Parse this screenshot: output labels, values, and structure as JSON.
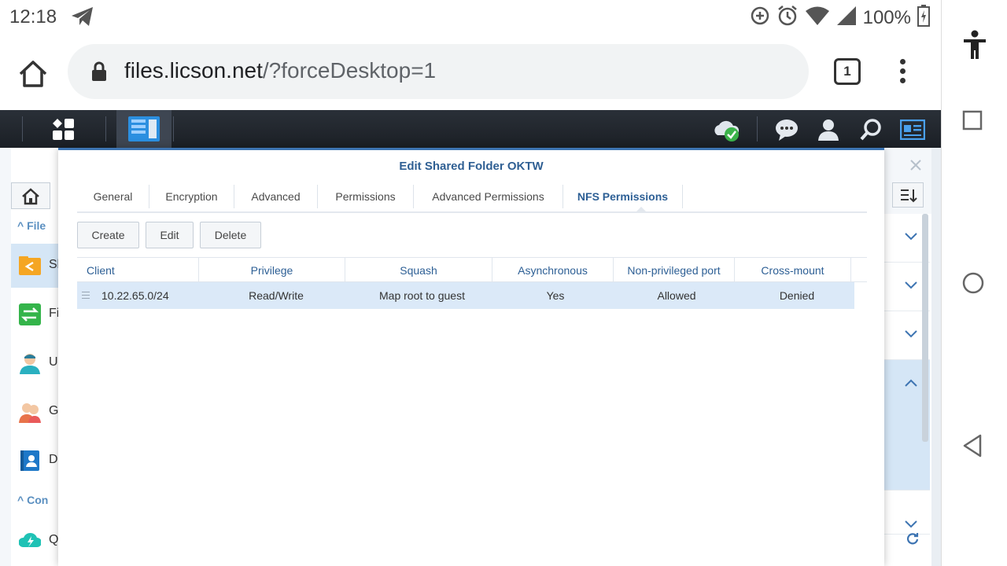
{
  "status_bar": {
    "time": "12:18",
    "battery": "100%",
    "icons": [
      "telegram-icon",
      "data-saver-icon",
      "alarm-icon",
      "wifi-icon",
      "signal-icon",
      "battery-charging-icon"
    ]
  },
  "browser": {
    "url_host": "files.licson.net",
    "url_path": "/?forceDesktop=1",
    "tab_count": "1"
  },
  "dialog": {
    "title": "Edit Shared Folder OKTW",
    "tabs": [
      {
        "label": "General"
      },
      {
        "label": "Encryption"
      },
      {
        "label": "Advanced"
      },
      {
        "label": "Permissions"
      },
      {
        "label": "Advanced Permissions"
      },
      {
        "label": "NFS Permissions",
        "active": true
      }
    ],
    "buttons": {
      "create": "Create",
      "edit": "Edit",
      "delete": "Delete"
    },
    "columns": [
      "Client",
      "Privilege",
      "Squash",
      "Asynchronous",
      "Non-privileged port",
      "Cross-mount"
    ],
    "rows": [
      {
        "client": "10.22.65.0/24",
        "privilege": "Read/Write",
        "squash": "Map root to guest",
        "asynchronous": "Yes",
        "nonprivileged_port": "Allowed",
        "cross_mount": "Denied"
      }
    ]
  },
  "control_panel": {
    "sections": [
      "File",
      "Con"
    ],
    "side_items": [
      {
        "label": "Sl",
        "icon": "shared-folder-icon"
      },
      {
        "label": "Fi",
        "icon": "file-services-icon"
      },
      {
        "label": "U",
        "icon": "user-icon"
      },
      {
        "label": "G",
        "icon": "group-icon"
      },
      {
        "label": "D",
        "icon": "domain-icon"
      },
      {
        "label": "Q",
        "icon": "quickconnect-icon"
      }
    ]
  }
}
